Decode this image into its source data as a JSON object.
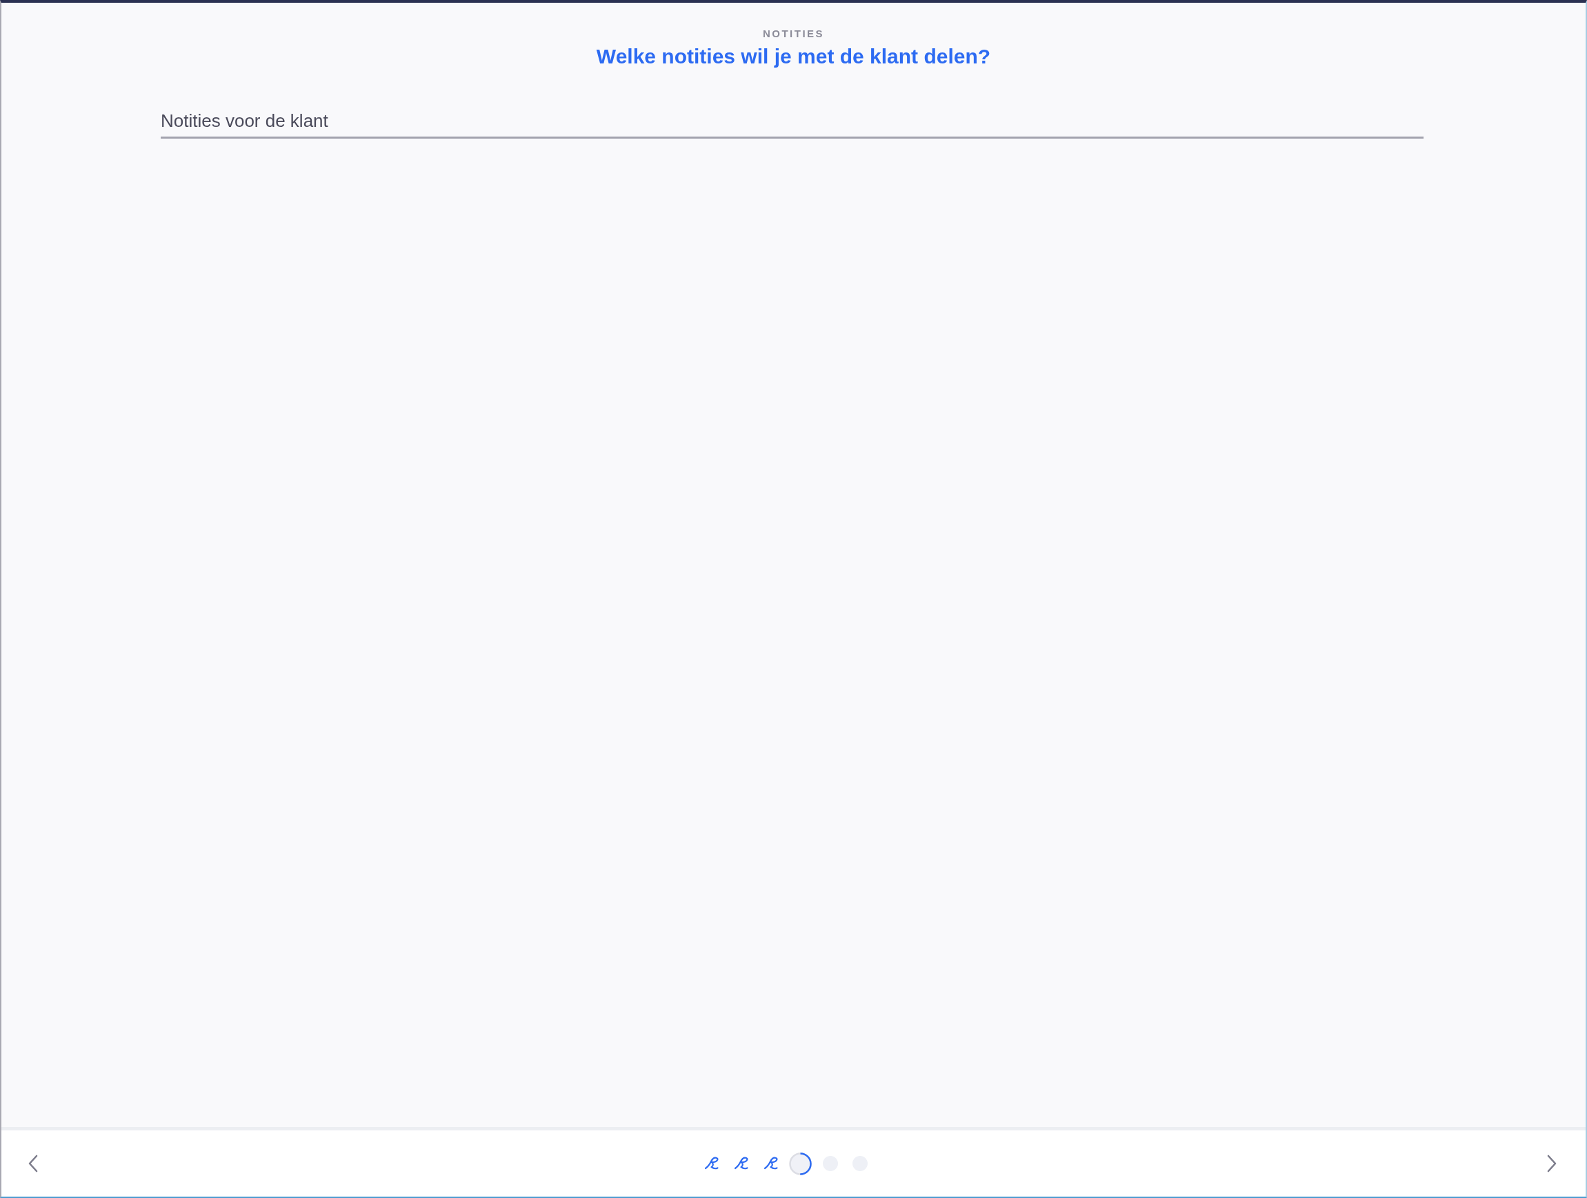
{
  "header": {
    "eyebrow": "NOTITIES",
    "title": "Welke notities wil je met de klant delen?"
  },
  "notes_field": {
    "placeholder": "Notities voor de klant"
  },
  "stepper": {
    "steps": [
      {
        "kind": "done"
      },
      {
        "kind": "done"
      },
      {
        "kind": "done"
      },
      {
        "kind": "current",
        "level": 0.5
      },
      {
        "kind": "upcoming"
      },
      {
        "kind": "upcoming"
      }
    ]
  }
}
